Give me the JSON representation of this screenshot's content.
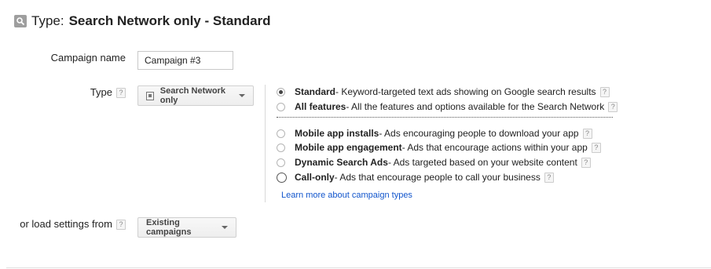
{
  "header": {
    "label": "Type:",
    "value": "Search Network only - Standard",
    "icon": "search-icon"
  },
  "campaign_name": {
    "label": "Campaign name",
    "value": "Campaign #3"
  },
  "type": {
    "label": "Type",
    "help": "?",
    "dropdown_label": "Search Network only"
  },
  "options": [
    {
      "title": "Standard",
      "desc": " - Keyword-targeted text ads showing on Google search results",
      "help": "?",
      "selected": true
    },
    {
      "title": "All features",
      "desc": " - All the features and options available for the Search Network",
      "help": "?",
      "selected": false
    },
    {
      "title": "Mobile app installs",
      "desc": " - Ads encouraging people to download your app",
      "help": "?",
      "selected": false
    },
    {
      "title": "Mobile app engagement",
      "desc": " - Ads that encourage actions within your app",
      "help": "?",
      "selected": false
    },
    {
      "title": "Dynamic Search Ads",
      "desc": " - Ads targeted based on your website content",
      "help": "?",
      "selected": false
    },
    {
      "title": "Call-only",
      "desc": " - Ads that encourage people to call your business",
      "help": "?",
      "selected": false
    }
  ],
  "learn_more": "Learn more about campaign types",
  "load_settings": {
    "label": "or load settings from",
    "help": "?",
    "dropdown_label": "Existing campaigns"
  },
  "colors": {
    "link": "#1155cc",
    "text": "#222222",
    "border": "#d0d0d0"
  }
}
